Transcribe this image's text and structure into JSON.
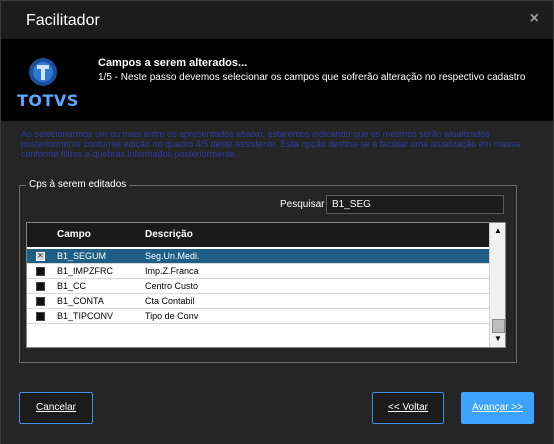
{
  "window": {
    "title": "Facilitador",
    "close_glyph": "×"
  },
  "header": {
    "logo_text": "TOTVS",
    "step_title": "Campos a serem alterados...",
    "step_description": "1/5 - Neste passo devemos selecionar os campos que sofrerão alteração no respectivo cadastro"
  },
  "info_text": "Ao selecionarmos um ou mais entre os apresentados abaixo, estaremos indicando que os mesmos serão atualizados posteriormente conforme edição no quadro 4/5 deste assistente. Esta opção destina-se a facilitar uma atualização em massa conforme filtros e quebras informados posteriormente.",
  "group": {
    "legend": "Cps à serem editados",
    "search_label": "Pesquisar",
    "search_value": "B1_SEG"
  },
  "grid": {
    "columns": [
      "Campo",
      "Descrição"
    ],
    "rows": [
      {
        "checked": true,
        "selected": true,
        "campo": "B1_SEGUM",
        "descricao": "Seg.Un.Medi."
      },
      {
        "checked": false,
        "selected": false,
        "campo": "B1_IMPZFRC",
        "descricao": "Imp.Z.Franca"
      },
      {
        "checked": false,
        "selected": false,
        "campo": "B1_CC",
        "descricao": "Centro Custo"
      },
      {
        "checked": false,
        "selected": false,
        "campo": "B1_CONTA",
        "descricao": "Cta Contabil"
      },
      {
        "checked": false,
        "selected": false,
        "campo": "B1_TIPCONV",
        "descricao": "Tipo de Conv"
      }
    ]
  },
  "buttons": {
    "cancel": "Cancelar",
    "back": "<< Voltar",
    "next": "Avançar >>"
  },
  "colors": {
    "accent": "#3da3ff",
    "selection": "#1f5f86",
    "info_text": "#2d3a9e",
    "logo": "#5aa7ff"
  }
}
